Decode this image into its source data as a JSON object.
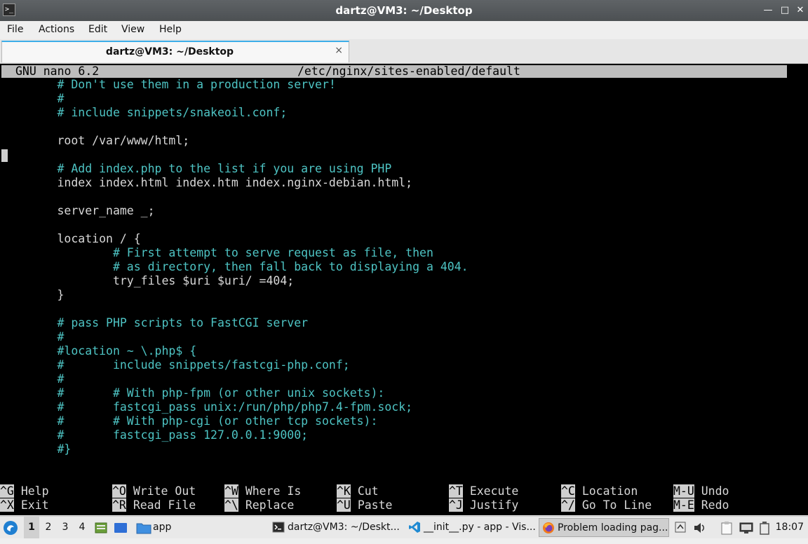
{
  "window": {
    "title": "dartz@VM3: ~/Desktop",
    "terminal_icon_glyph": ">_",
    "minimize_glyph": "—",
    "maximize_glyph": "□",
    "close_glyph": "✕"
  },
  "menu": [
    "File",
    "Actions",
    "Edit",
    "View",
    "Help"
  ],
  "tab": {
    "title": "dartz@VM3: ~/Desktop",
    "close_glyph": "×"
  },
  "nano": {
    "version": "GNU nano 6.2",
    "filename": "/etc/nginx/sites-enabled/default",
    "lines": [
      {
        "text": "        # Don't use them in a production server!",
        "type": "comment"
      },
      {
        "text": "        #",
        "type": "comment"
      },
      {
        "text": "        # include snippets/snakeoil.conf;",
        "type": "comment"
      },
      {
        "text": "",
        "type": "code"
      },
      {
        "text": "        root /var/www/html;",
        "type": "code"
      },
      {
        "text": "",
        "type": "code"
      },
      {
        "text": "        # Add index.php to the list if you are using PHP",
        "type": "comment"
      },
      {
        "text": "        index index.html index.htm index.nginx-debian.html;",
        "type": "code"
      },
      {
        "text": "",
        "type": "code"
      },
      {
        "text": "        server_name _;",
        "type": "code"
      },
      {
        "text": "",
        "type": "code"
      },
      {
        "text": "        location / {",
        "type": "code"
      },
      {
        "text": "                # First attempt to serve request as file, then",
        "type": "comment"
      },
      {
        "text": "                # as directory, then fall back to displaying a 404.",
        "type": "comment"
      },
      {
        "text": "                try_files $uri $uri/ =404;",
        "type": "code"
      },
      {
        "text": "        }",
        "type": "code"
      },
      {
        "text": "",
        "type": "code"
      },
      {
        "text": "        # pass PHP scripts to FastCGI server",
        "type": "comment"
      },
      {
        "text": "        #",
        "type": "comment"
      },
      {
        "text": "        #location ~ \\.php$ {",
        "type": "comment"
      },
      {
        "text": "        #       include snippets/fastcgi-php.conf;",
        "type": "comment"
      },
      {
        "text": "        #",
        "type": "comment"
      },
      {
        "text": "        #       # With php-fpm (or other unix sockets):",
        "type": "comment"
      },
      {
        "text": "        #       fastcgi_pass unix:/run/php/php7.4-fpm.sock;",
        "type": "comment"
      },
      {
        "text": "        #       # With php-cgi (or other tcp sockets):",
        "type": "comment"
      },
      {
        "text": "        #       fastcgi_pass 127.0.0.1:9000;",
        "type": "comment"
      },
      {
        "text": "        #}",
        "type": "comment"
      }
    ],
    "shortcuts": [
      {
        "key": "^G",
        "label": "Help"
      },
      {
        "key": "^O",
        "label": "Write Out"
      },
      {
        "key": "^W",
        "label": "Where Is"
      },
      {
        "key": "^K",
        "label": "Cut"
      },
      {
        "key": "^T",
        "label": "Execute"
      },
      {
        "key": "^C",
        "label": "Location"
      },
      {
        "key": "M-U",
        "label": "Undo"
      },
      {
        "key": "^X",
        "label": "Exit"
      },
      {
        "key": "^R",
        "label": "Read File"
      },
      {
        "key": "^\\",
        "label": "Replace"
      },
      {
        "key": "^U",
        "label": "Paste"
      },
      {
        "key": "^J",
        "label": "Justify"
      },
      {
        "key": "^/",
        "label": "Go To Line"
      },
      {
        "key": "M-E",
        "label": "Redo"
      }
    ]
  },
  "taskbar": {
    "workspaces": [
      "1",
      "2",
      "3",
      "4"
    ],
    "active_workspace": "1",
    "folder_label": "app",
    "tasks": [
      {
        "label": "dartz@VM3: ~/Deskt...",
        "icon": "terminal-icon"
      },
      {
        "label": "__init__.py - app - Vis...",
        "icon": "vscode-icon"
      },
      {
        "label": "Problem loading pag...",
        "icon": "firefox-icon"
      }
    ],
    "clock": "18:07"
  }
}
